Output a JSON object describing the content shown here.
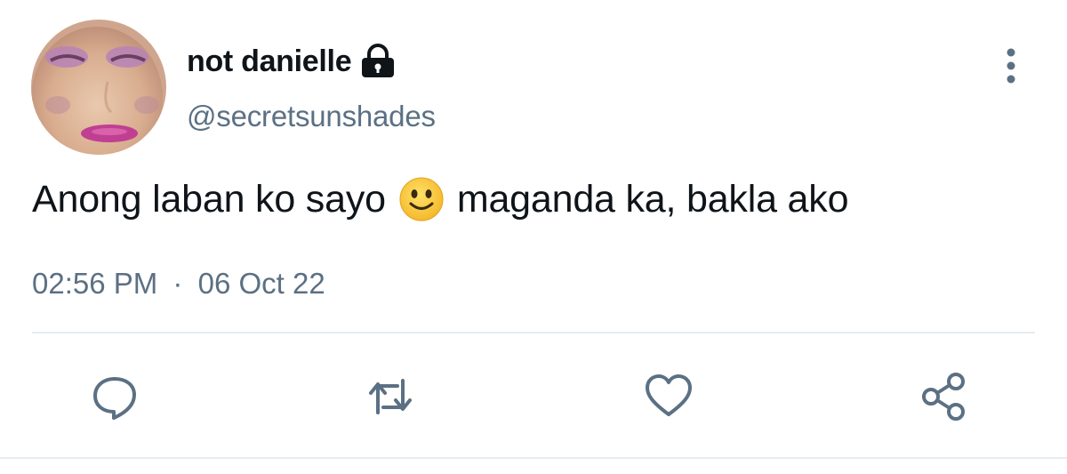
{
  "user": {
    "display_name": "not danielle",
    "handle": "@secretsunshades",
    "protected_icon": "lock-icon",
    "avatar": "profile-photo"
  },
  "tweet": {
    "text_before_emoji": "Anong laban ko sayo",
    "emoji": "slightly-smiling-face",
    "text_after_emoji": "maganda ka, bakla ako",
    "time": "02:56 PM",
    "separator": "·",
    "date": "06 Oct 22"
  },
  "actions": [
    {
      "name": "reply",
      "icon": "comment-icon"
    },
    {
      "name": "retweet",
      "icon": "retweet-icon"
    },
    {
      "name": "like",
      "icon": "heart-icon"
    },
    {
      "name": "share",
      "icon": "share-icon"
    }
  ],
  "menu": {
    "icon": "more-vertical-icon"
  },
  "colors": {
    "text_primary": "#0f1419",
    "text_secondary": "#5b7083",
    "divider": "#e6ecf0",
    "emoji_yellow": "#f7c13a"
  }
}
